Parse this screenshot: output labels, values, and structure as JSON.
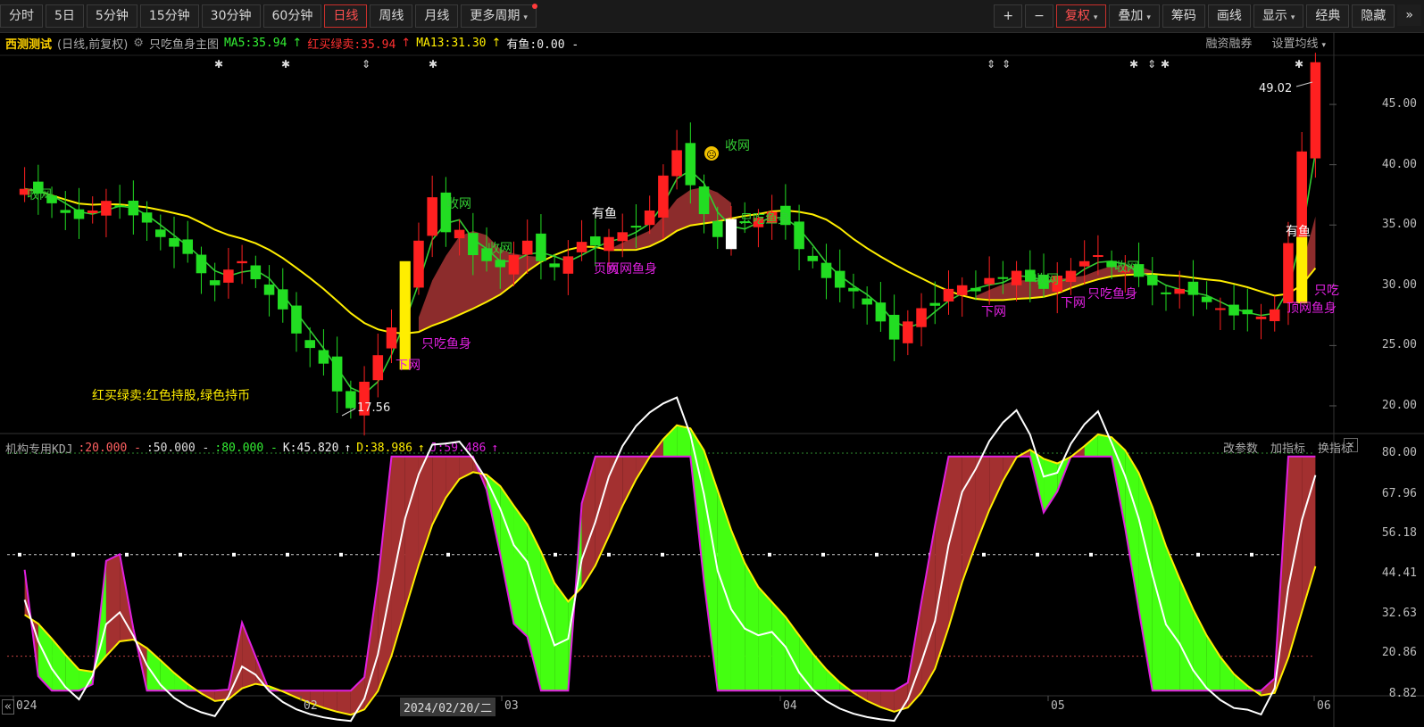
{
  "toolbar": {
    "left_buttons": [
      "分时",
      "5日",
      "5分钟",
      "15分钟",
      "30分钟",
      "60分钟",
      "日线",
      "周线",
      "月线",
      "更多周期"
    ],
    "active": "日线",
    "right_buttons": [
      "+",
      "−",
      "复权",
      "叠加",
      "筹码",
      "画线",
      "显示",
      "经典",
      "隐藏"
    ],
    "right_close": "»"
  },
  "main_header": {
    "stock_name": "西测测试",
    "period_info": "(日线,前复权)",
    "indicator_name": "只吃鱼身主图",
    "ma5": "MA5:35.94",
    "hongmai": "红买绿卖:35.94",
    "ma13": "MA13:31.30",
    "youyu": "有鱼:0.00 -",
    "right_links": [
      "融资融券",
      "设置均线"
    ]
  },
  "kdj_header": {
    "name": "机构专用KDJ",
    "l20": ":20.000 -",
    "l50": ":50.000 -",
    "l80": ":80.000 -",
    "k": "K:45.820",
    "d": "D:38.986",
    "j": "J:59.486",
    "right_links": [
      "改参数",
      "加指标",
      "换指标"
    ],
    "close": "×"
  },
  "price_axis": [
    "45.00",
    "40.00",
    "35.00",
    "30.00",
    "25.00",
    "20.00"
  ],
  "kdj_axis": [
    "80.00",
    "67.96",
    "56.18",
    "44.41",
    "32.63",
    "20.86",
    "8.82"
  ],
  "date_axis": {
    "labels": [
      "024",
      "02",
      "03",
      "04",
      "05",
      "06"
    ],
    "cursor": "2024/02/20/二",
    "left_arrow": "«"
  },
  "annotations": {
    "legend_text": "红买绿卖:红色持股,绿色持币",
    "low_price": "17.56",
    "high_price": "49.02",
    "signals": [
      "收网",
      "收网",
      "收网",
      "收网",
      "收网",
      "有鱼",
      "有鱼",
      "下网",
      "下网",
      "下网",
      "只吃鱼身",
      "只吃鱼身",
      "只吃鱼身",
      "只吃",
      "页网",
      "页网鱼身",
      "顶网鱼身",
      "收网"
    ]
  },
  "colors": {
    "up": "#ff2020",
    "down": "#22dd22",
    "ma_red": "#ff3030",
    "ma_yellow": "#ffee00",
    "green_line": "#33cc33",
    "ribbon": "#9b3131",
    "magenta": "#e020e0",
    "kdj_green": "#44ff11",
    "kdj_red": "#a33030"
  },
  "chart_data": [
    {
      "type": "candlestick",
      "title": "",
      "ylim": [
        18,
        49
      ],
      "y_ticks": [
        20,
        25,
        30,
        35,
        40,
        45
      ],
      "series": [
        {
          "name": "MA5",
          "last": 35.94
        },
        {
          "name": "MA13",
          "last": 31.3
        }
      ],
      "approx_close": [
        38.0,
        37.6,
        36.8,
        36.0,
        35.5,
        36.2,
        37.0,
        36.5,
        35.8,
        35.2,
        34.0,
        33.2,
        32.6,
        31.0,
        30.0,
        31.3,
        32.0,
        30.5,
        29.2,
        28.0,
        26.0,
        24.8,
        23.5,
        21.2,
        19.8,
        22.0,
        24.2,
        26.5,
        30.3,
        33.7,
        37.3,
        34.4,
        34.6,
        32.5,
        32.0,
        31.5,
        32.5,
        33.7,
        32.0,
        31.5,
        32.4,
        33.6,
        33.3,
        34.0,
        34.4,
        34.8,
        36.2,
        39.1,
        41.2,
        38.3,
        35.9,
        34.0,
        34.8,
        35.2,
        35.6,
        36.1,
        35.0,
        33.0,
        32.0,
        30.6,
        29.8,
        29.5,
        28.4,
        27.0,
        25.5,
        27.0,
        28.1,
        28.3,
        29.7,
        30.0,
        29.5,
        30.6,
        30.6,
        31.2,
        30.3,
        29.7,
        30.8,
        31.2,
        32.0,
        32.5,
        31.5,
        31.2,
        30.7,
        30.0,
        29.3,
        29.7,
        29.2,
        28.6,
        28.1,
        27.5,
        27.6,
        27.4,
        28.0,
        33.5,
        41.1,
        48.5
      ]
    },
    {
      "type": "line",
      "title": "",
      "ylim": [
        8.82,
        80.0
      ],
      "series": [
        {
          "name": "K",
          "last": 45.82
        },
        {
          "name": "D",
          "last": 38.986
        },
        {
          "name": "J",
          "last": 59.486
        }
      ],
      "reference_lines": [
        20,
        50,
        80
      ]
    }
  ]
}
